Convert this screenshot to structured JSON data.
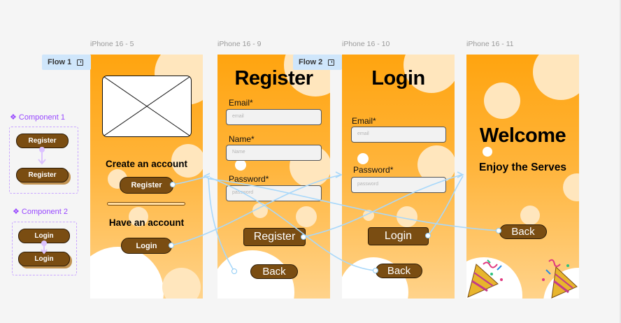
{
  "frames": {
    "f5": {
      "label": "iPhone 16 - 5"
    },
    "f9": {
      "label": "iPhone 16 - 9"
    },
    "f10": {
      "label": "iPhone 16 - 10"
    },
    "f11": {
      "label": "iPhone 16 - 11"
    }
  },
  "flows": {
    "flow1": "Flow 1",
    "flow2": "Flow 2"
  },
  "components": {
    "c1": {
      "label": "❖ Component 1",
      "btn_a": "Register",
      "btn_b": "Register"
    },
    "c2": {
      "label": "❖ Component 2",
      "btn_a": "Login",
      "btn_b": "Login"
    }
  },
  "screen_start": {
    "create_account": "Create an account",
    "register_btn": "Register",
    "have_account": "Have an account",
    "login_btn": "Login"
  },
  "screen_register": {
    "title": "Register",
    "email_label": "Email*",
    "email_placeholder": "email",
    "name_label": "Name*",
    "name_placeholder": "Name",
    "password_label": "Password*",
    "password_placeholder": "password",
    "register_btn": "Register",
    "back_btn": "Back"
  },
  "screen_login": {
    "title": "Login",
    "email_label": "Email*",
    "email_placeholder": "email",
    "password_label": "Password*",
    "password_placeholder": "password",
    "login_btn": "Login",
    "back_btn": "Back"
  },
  "screen_welcome": {
    "title": "Welcome",
    "subtitle": "Enjoy the Serves",
    "back_btn": "Back"
  },
  "colors": {
    "frame_top": "#ffa40f",
    "frame_bottom": "#ffd38b",
    "button": "#7a4d12",
    "prototype_line": "#a9d8fa",
    "component_purple": "#9747ff"
  }
}
